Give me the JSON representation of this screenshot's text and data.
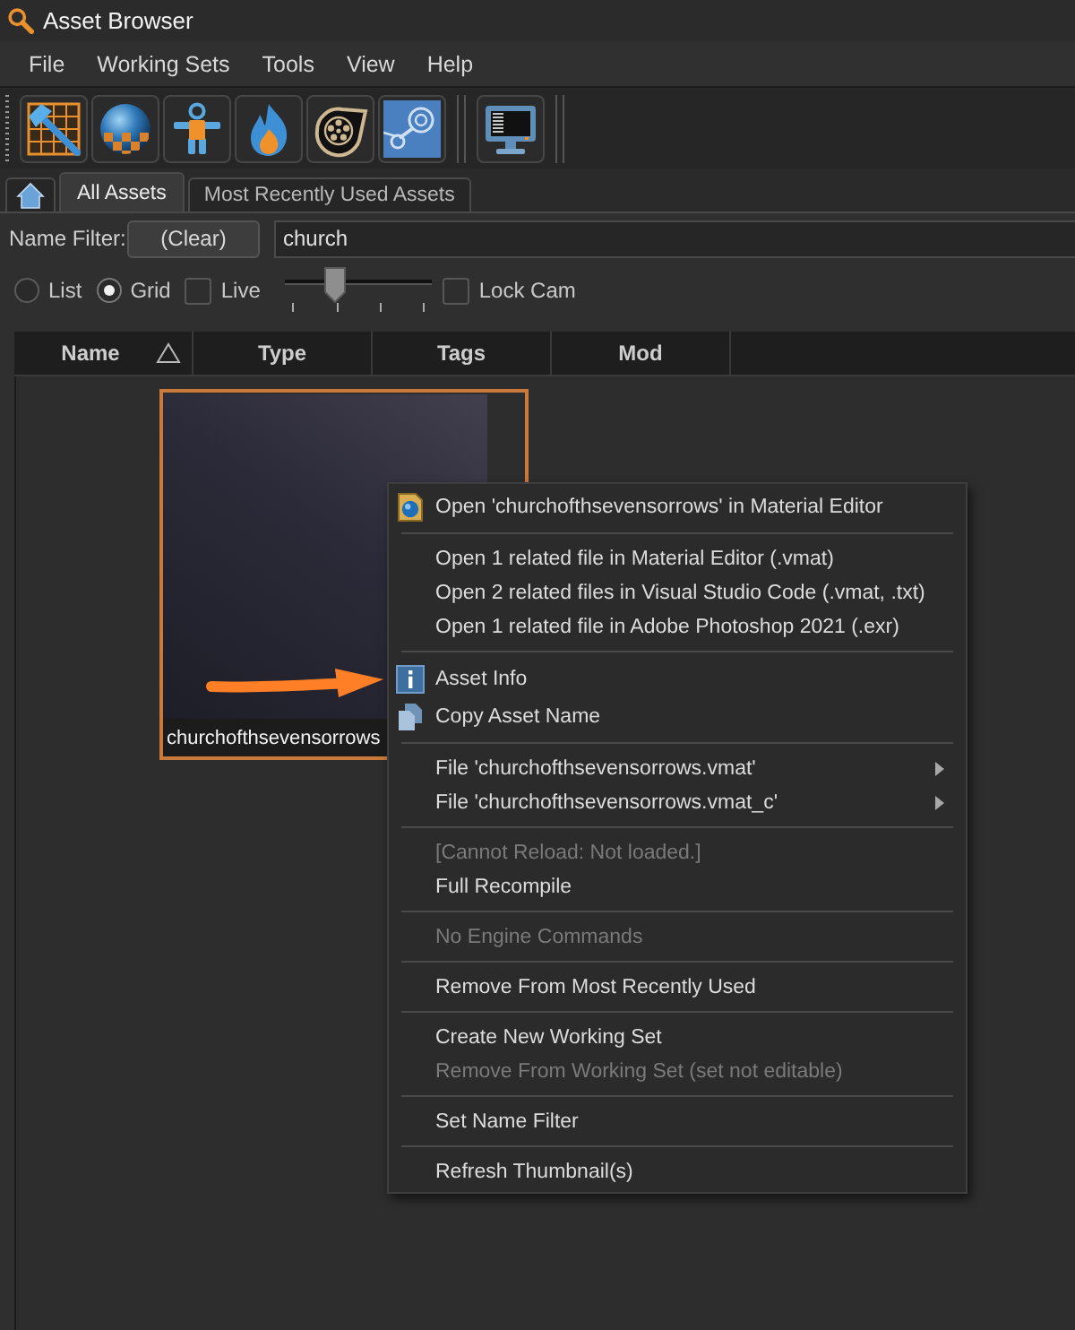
{
  "window": {
    "title": "Asset Browser"
  },
  "menu_bar": [
    "File",
    "Working Sets",
    "Tools",
    "View",
    "Help"
  ],
  "tabs": [
    {
      "kind": "home",
      "selected": false
    },
    {
      "kind": "text",
      "label": "All Assets",
      "selected": true
    },
    {
      "kind": "text",
      "label": "Most Recently Used Assets",
      "selected": false
    }
  ],
  "name_filter": {
    "label": "Name Filter:",
    "clear_button": "(Clear)",
    "value": "church"
  },
  "view_options": {
    "modes": [
      {
        "label": "List",
        "selected": false
      },
      {
        "label": "Grid",
        "selected": true
      }
    ],
    "live": {
      "label": "Live",
      "checked": false
    },
    "zoom_slider": {
      "level": 0.33
    },
    "lock_cam": {
      "label": "Lock Cam",
      "checked": false
    }
  },
  "columns": [
    {
      "label": "Name",
      "sorted": true
    },
    {
      "label": "Type",
      "sorted": false
    },
    {
      "label": "Tags",
      "sorted": false
    },
    {
      "label": "Mod",
      "sorted": false
    }
  ],
  "assets": [
    {
      "name": "churchofthsevensorrows",
      "selected": true
    }
  ],
  "context_menu": {
    "items": [
      {
        "kind": "action",
        "label": "Open 'churchofthsevensorrows' in Material Editor",
        "disabled": false,
        "has_submenu": false
      },
      {
        "kind": "separator"
      },
      {
        "kind": "action",
        "label": "Open 1 related file in Material Editor (.vmat)",
        "disabled": false,
        "has_submenu": false
      },
      {
        "kind": "action",
        "label": "Open 2 related files in Visual Studio Code (.vmat, .txt)",
        "disabled": false,
        "has_submenu": false
      },
      {
        "kind": "action",
        "label": "Open 1 related file in Adobe Photoshop 2021 (.exr)",
        "disabled": false,
        "has_submenu": false
      },
      {
        "kind": "separator"
      },
      {
        "kind": "action",
        "label": "Asset Info",
        "disabled": false,
        "has_submenu": false
      },
      {
        "kind": "action",
        "label": "Copy Asset Name",
        "disabled": false,
        "has_submenu": false
      },
      {
        "kind": "separator"
      },
      {
        "kind": "action",
        "label": "File 'churchofthsevensorrows.vmat'",
        "disabled": false,
        "has_submenu": true
      },
      {
        "kind": "action",
        "label": "File 'churchofthsevensorrows.vmat_c'",
        "disabled": false,
        "has_submenu": true
      },
      {
        "kind": "separator"
      },
      {
        "kind": "action",
        "label": "[Cannot Reload: Not loaded.]",
        "disabled": true,
        "has_submenu": false
      },
      {
        "kind": "action",
        "label": "Full Recompile",
        "disabled": false,
        "has_submenu": false
      },
      {
        "kind": "separator"
      },
      {
        "kind": "action",
        "label": "No Engine Commands",
        "disabled": true,
        "has_submenu": false
      },
      {
        "kind": "separator"
      },
      {
        "kind": "action",
        "label": "Remove From Most Recently Used",
        "disabled": false,
        "has_submenu": false
      },
      {
        "kind": "separator"
      },
      {
        "kind": "action",
        "label": "Create New Working Set",
        "disabled": false,
        "has_submenu": false
      },
      {
        "kind": "action",
        "label": "Remove From Working Set (set not editable)",
        "disabled": true,
        "has_submenu": false
      },
      {
        "kind": "separator"
      },
      {
        "kind": "action",
        "label": "Set Name Filter",
        "disabled": false,
        "has_submenu": false
      },
      {
        "kind": "separator"
      },
      {
        "kind": "action",
        "label": "Refresh Thumbnail(s)",
        "disabled": false,
        "has_submenu": false
      }
    ]
  }
}
